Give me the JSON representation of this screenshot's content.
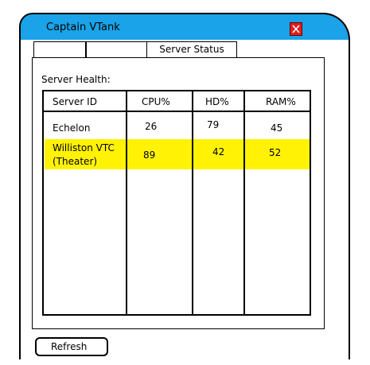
{
  "window": {
    "title": "Captain VTank"
  },
  "tabs": [
    {
      "label": ""
    },
    {
      "label": ""
    },
    {
      "label": "Server Status"
    }
  ],
  "panel": {
    "section_label": "Server Health:"
  },
  "table": {
    "columns": [
      "Server ID",
      "CPU%",
      "HD%",
      "RAM%"
    ],
    "rows": [
      {
        "server_id": "Echelon",
        "cpu": "26",
        "hd": "79",
        "ram": "45",
        "selected": false
      },
      {
        "server_id_line1": "Williston VTC",
        "server_id_line2": "(Theater)",
        "cpu": "89",
        "hd": "42",
        "ram": "52",
        "selected": true
      }
    ],
    "highlight_color": "#fff205"
  },
  "buttons": {
    "refresh": "Refresh"
  },
  "colors": {
    "titlebar": "#1aa3e8",
    "close": "#e41d1d"
  }
}
